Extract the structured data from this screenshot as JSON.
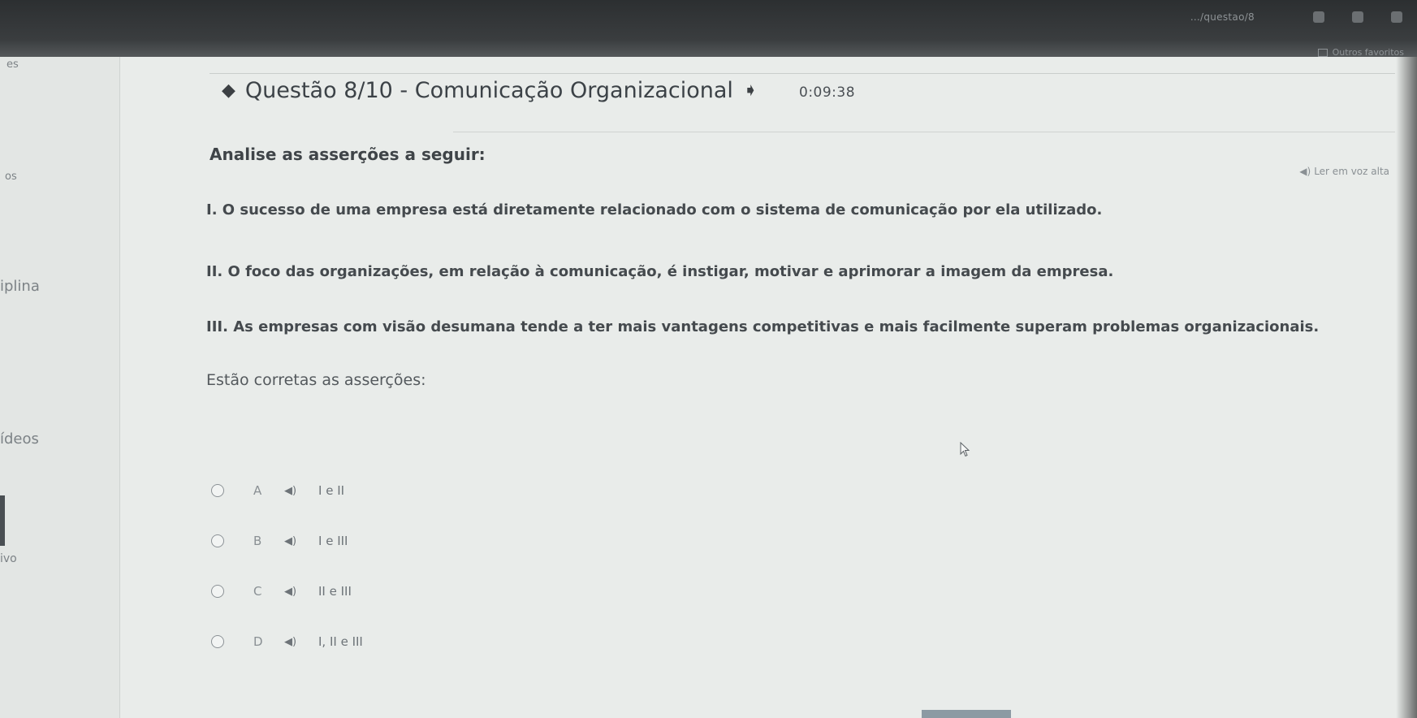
{
  "browser": {
    "url_fragment": "…/questao/8",
    "favorites_label": "Outros favoritos"
  },
  "sidebar": {
    "items": [
      "es",
      "os",
      "iplina",
      "ídeos",
      "ivo"
    ]
  },
  "question": {
    "title": "Questão 8/10 - Comunicação Organizacional",
    "timer": "0:09:38",
    "read_aloud": "Ler em voz alta",
    "intro": "Analise as asserções a seguir:",
    "assertions": [
      "I. O sucesso de uma empresa está diretamente relacionado com o sistema de comunicação por ela utilizado.",
      "II. O foco das organizações, em relação à comunicação, é instigar, motivar e aprimorar a imagem da empresa.",
      "III. As empresas com visão desumana tende a ter mais vantagens competitivas e mais facilmente superam problemas organizacionais."
    ],
    "prompt": "Estão corretas as asserções:"
  },
  "options": [
    {
      "letter": "A",
      "text": "I e II"
    },
    {
      "letter": "B",
      "text": "I e III"
    },
    {
      "letter": "C",
      "text": "II e III"
    },
    {
      "letter": "D",
      "text": "I, II e III"
    }
  ],
  "icons": {
    "prev": "arrow-left-icon",
    "next": "arrow-right-icon",
    "audio": "speaker-icon"
  }
}
